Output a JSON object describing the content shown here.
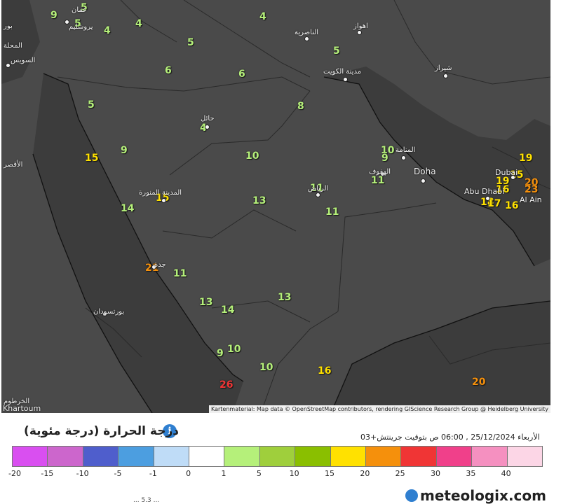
{
  "map": {
    "attribution": "Kartenmaterial: Map data © OpenStreetMap contributors, rendering GIScience Research Group @ Heidelberg University",
    "temperatures": [
      "9",
      "5",
      "5",
      "4",
      "4",
      "4",
      "5",
      "6",
      "6",
      "5",
      "5",
      "8",
      "4",
      "10",
      "15",
      "9",
      "10",
      "9",
      "19",
      "15",
      "19",
      "16",
      "20",
      "23",
      "15",
      "11",
      "13",
      "11",
      "11",
      "18",
      "17",
      "16",
      "14",
      "21",
      "11",
      "13",
      "14",
      "13",
      "10",
      "9",
      "10",
      "16",
      "26",
      "20"
    ],
    "places": [
      "عمان",
      "يروشليم",
      "بور",
      "المحلة",
      "السويس",
      "الناصرية",
      "اهواز",
      "مدينة الكويت",
      "شيراز",
      "حائل",
      "الرياض",
      "المدينة المنورة",
      "الهفوف",
      "المنامة",
      "Doha",
      "Dubai",
      "Abu Dhabi",
      "Al Ain",
      "جدة",
      "بورتسودان",
      "الخرطوم",
      "الأقصر",
      "Khartoum"
    ]
  },
  "legend": {
    "title": "درجة الحرارة (درجة مئوية)",
    "info_icon": "info-icon",
    "date": "الأربعاء 25/12/2024 , 06:00 ص بتوقيت جرينتش+03",
    "colors": [
      "#d94ff0",
      "#cc66cc",
      "#4f5ecc",
      "#4c9ee0",
      "#bfdcf7",
      "#ffffff",
      "#b5f07a",
      "#9fcf3c",
      "#8abf00",
      "#ffe100",
      "#f5900c",
      "#f03535",
      "#f0408a",
      "#f590c0",
      "#fcd6e6"
    ],
    "ticks": [
      "-20",
      "-15",
      "-10",
      "-5",
      "-1",
      "0",
      "1",
      "5",
      "10",
      "15",
      "20",
      "25",
      "30",
      "35",
      "40"
    ]
  },
  "brand": {
    "name": "meteologix.com"
  },
  "bottom_note": "... 5.3 ..."
}
